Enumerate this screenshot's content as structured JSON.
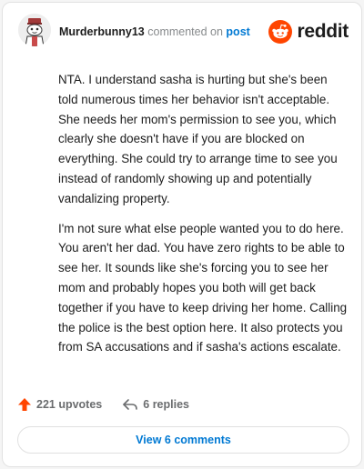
{
  "comment": {
    "username": "Murderbunny13",
    "commented_text": "commented on",
    "post_link": "post",
    "paragraphs": [
      "NTA. I understand sasha is hurting but she's been told numerous times her behavior isn't acceptable. She needs her mom's permission to see you, which clearly she doesn't have if you are blocked on everything. She could try to arrange time to see you instead of randomly showing up and potentially vandalizing property.",
      "I'm not sure what else people wanted you to do here. You aren't her dad. You have zero rights to be able to see her. It sounds like she's forcing you to see her mom and probably hopes you both will get back together if you have to keep driving her home. Calling the police is the best option here. It also protects you from SA accusations and if sasha's actions escalate."
    ],
    "upvotes": "221 upvotes",
    "replies": "6 replies",
    "view_comments": "View 6 comments"
  },
  "brand": {
    "name": "reddit",
    "accent": "#ff4500"
  },
  "icons": {
    "avatar": "snoo-avatar",
    "logo": "reddit-snoo-icon",
    "upvote": "upvote-arrow-icon",
    "reply": "reply-arrow-icon"
  },
  "colors": {
    "username": "#1c1c1c",
    "meta": "#878a8c",
    "link": "#0079d3",
    "upvote": "#ff4500",
    "footer": "#6a6c6e"
  }
}
